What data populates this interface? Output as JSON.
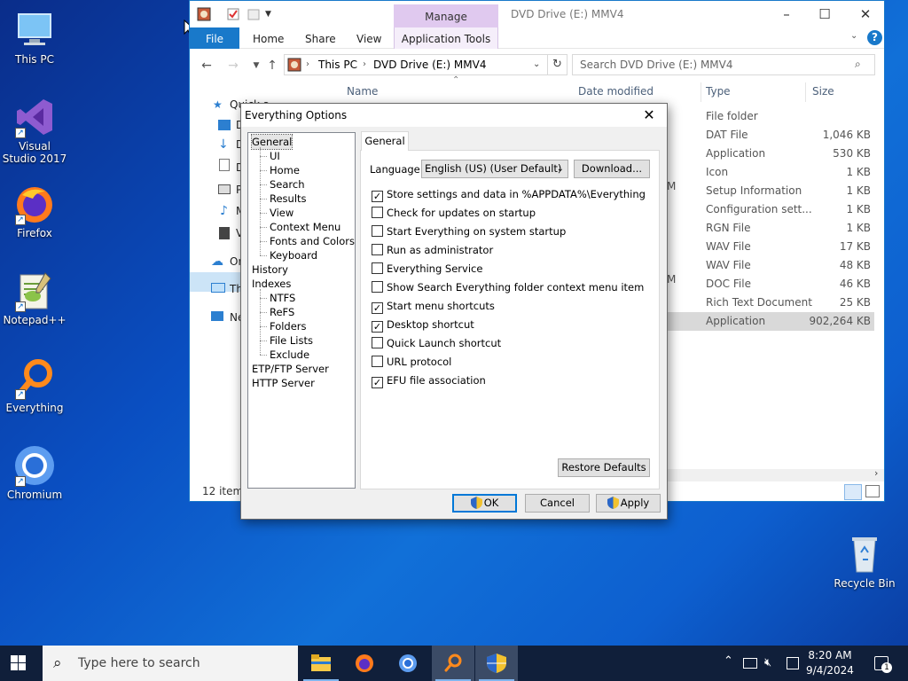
{
  "desktop": {
    "icons": [
      {
        "label": "This PC"
      },
      {
        "label": "Visual Studio 2017"
      },
      {
        "label": "Firefox"
      },
      {
        "label": "Notepad++"
      },
      {
        "label": "Everything"
      },
      {
        "label": "Chromium"
      },
      {
        "label": "Recycle Bin"
      }
    ]
  },
  "explorer": {
    "title": "DVD Drive (E:) MMV4",
    "manage_tab": "Manage",
    "ribbon_tabs": [
      "File",
      "Home",
      "Share",
      "View",
      "Application Tools"
    ],
    "address": {
      "parts": [
        "This PC",
        "DVD Drive (E:) MMV4"
      ]
    },
    "search_placeholder": "Search DVD Drive (E:) MMV4",
    "columns": {
      "name": "Name",
      "date": "Date modified",
      "type": "Type",
      "size": "Size"
    },
    "rows": [
      {
        "type": "File folder",
        "size": ""
      },
      {
        "type": "DAT File",
        "size": "1,046 KB"
      },
      {
        "type": "Application",
        "size": "530 KB"
      },
      {
        "type": "Icon",
        "size": "1 KB"
      },
      {
        "type": "Setup Information",
        "size": "1 KB"
      },
      {
        "type": "Configuration sett...",
        "size": "1 KB"
      },
      {
        "type": "RGN File",
        "size": "1 KB"
      },
      {
        "type": "WAV File",
        "size": "17 KB"
      },
      {
        "type": "WAV File",
        "size": "48 KB"
      },
      {
        "type": "DOC File",
        "size": "46 KB"
      },
      {
        "type": "Rich Text Document",
        "size": "25 KB"
      },
      {
        "type": "Application",
        "size": "902,264 KB"
      }
    ],
    "nav_partial": [
      "Quick a",
      "D",
      "D",
      "D",
      "P",
      "M",
      "V",
      "Or",
      "Th",
      "Ne"
    ],
    "status": "12 items",
    "date_fragments": [
      "M",
      "M"
    ]
  },
  "dialog": {
    "title": "Everything Options",
    "tree": [
      {
        "label": "General",
        "level": 0
      },
      {
        "label": "UI",
        "level": 1
      },
      {
        "label": "Home",
        "level": 1
      },
      {
        "label": "Search",
        "level": 1
      },
      {
        "label": "Results",
        "level": 1
      },
      {
        "label": "View",
        "level": 1
      },
      {
        "label": "Context Menu",
        "level": 1
      },
      {
        "label": "Fonts and Colors",
        "level": 1
      },
      {
        "label": "Keyboard",
        "level": 1
      },
      {
        "label": "History",
        "level": 0
      },
      {
        "label": "Indexes",
        "level": 0
      },
      {
        "label": "NTFS",
        "level": 1
      },
      {
        "label": "ReFS",
        "level": 1
      },
      {
        "label": "Folders",
        "level": 1
      },
      {
        "label": "File Lists",
        "level": 1
      },
      {
        "label": "Exclude",
        "level": 1
      },
      {
        "label": "ETP/FTP Server",
        "level": 0
      },
      {
        "label": "HTTP Server",
        "level": 0
      }
    ],
    "tab": "General",
    "language_label": "Language:",
    "language_value": "English (US) (User Default)",
    "download_button": "Download...",
    "options": [
      {
        "label": "Store settings and data in %APPDATA%\\Everything",
        "checked": true
      },
      {
        "label": "Check for updates on startup",
        "checked": false
      },
      {
        "label": "Start Everything on system startup",
        "checked": false
      },
      {
        "label": "Run as administrator",
        "checked": false
      },
      {
        "label": "Everything Service",
        "checked": false
      },
      {
        "label": "Show Search Everything folder context menu item",
        "checked": false
      },
      {
        "label": "Start menu shortcuts",
        "checked": true
      },
      {
        "label": "Desktop shortcut",
        "checked": true
      },
      {
        "label": "Quick Launch shortcut",
        "checked": false
      },
      {
        "label": "URL protocol",
        "checked": false
      },
      {
        "label": "EFU file association",
        "checked": true
      }
    ],
    "restore_button": "Restore Defaults",
    "ok_button": "OK",
    "cancel_button": "Cancel",
    "apply_button": "Apply"
  },
  "taskbar": {
    "search_placeholder": "Type here to search",
    "time": "8:20 AM",
    "date": "9/4/2024",
    "notification_count": "1"
  },
  "colors": {
    "accent": "#1979ca",
    "manage": "#e0c9ef",
    "taskbar": "#101f3a"
  }
}
